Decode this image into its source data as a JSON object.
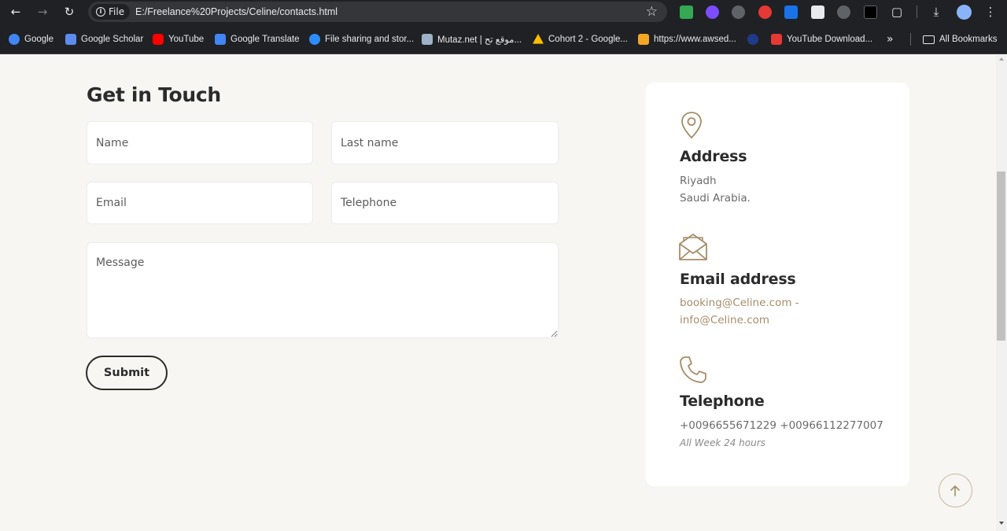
{
  "browser": {
    "site_chip_label": "File",
    "url": "E:/Freelance%20Projects/Celine/contacts.html",
    "bookmarks": [
      {
        "label": "Google",
        "color": "#4285f4"
      },
      {
        "label": "Google Scholar",
        "color": "#5b8def"
      },
      {
        "label": "YouTube",
        "color": "#ff0000"
      },
      {
        "label": "Google Translate",
        "color": "#4285f4"
      },
      {
        "label": "File sharing and stor...",
        "color": "#2d8cff"
      },
      {
        "label": "Mutaz.net | موقع تح...",
        "color": "#9fb3c8"
      },
      {
        "label": "Cohort 2 - Google...",
        "color": "#fbbc04"
      },
      {
        "label": "https://www.awsed...",
        "color": "#f5a623"
      },
      {
        "label": "",
        "color": "#1f3a8a"
      },
      {
        "label": "YouTube Download...",
        "color": "#e53935"
      }
    ],
    "bookmarks_more": "»",
    "all_bookmarks_label": "All Bookmarks"
  },
  "form": {
    "title": "Get in Touch",
    "name_placeholder": "Name",
    "last_name_placeholder": "Last name",
    "email_placeholder": "Email",
    "telephone_placeholder": "Telephone",
    "message_placeholder": "Message",
    "submit_label": "Submit"
  },
  "contact_card": {
    "address": {
      "title": "Address",
      "line1": "Riyadh",
      "line2": "Saudi Arabia."
    },
    "email": {
      "title": "Email address",
      "line1": "booking@Celine.com -",
      "line2": "info@Celine.com"
    },
    "telephone": {
      "title": "Telephone",
      "numbers": "+0096655671229 +00966112277007",
      "hours": "All Week 24 hours"
    }
  },
  "colors": {
    "accent_gold": "#a68d6a",
    "text_dark": "#2b2b2b",
    "page_bg": "#f7f6f3",
    "card_bg": "#ffffff"
  }
}
